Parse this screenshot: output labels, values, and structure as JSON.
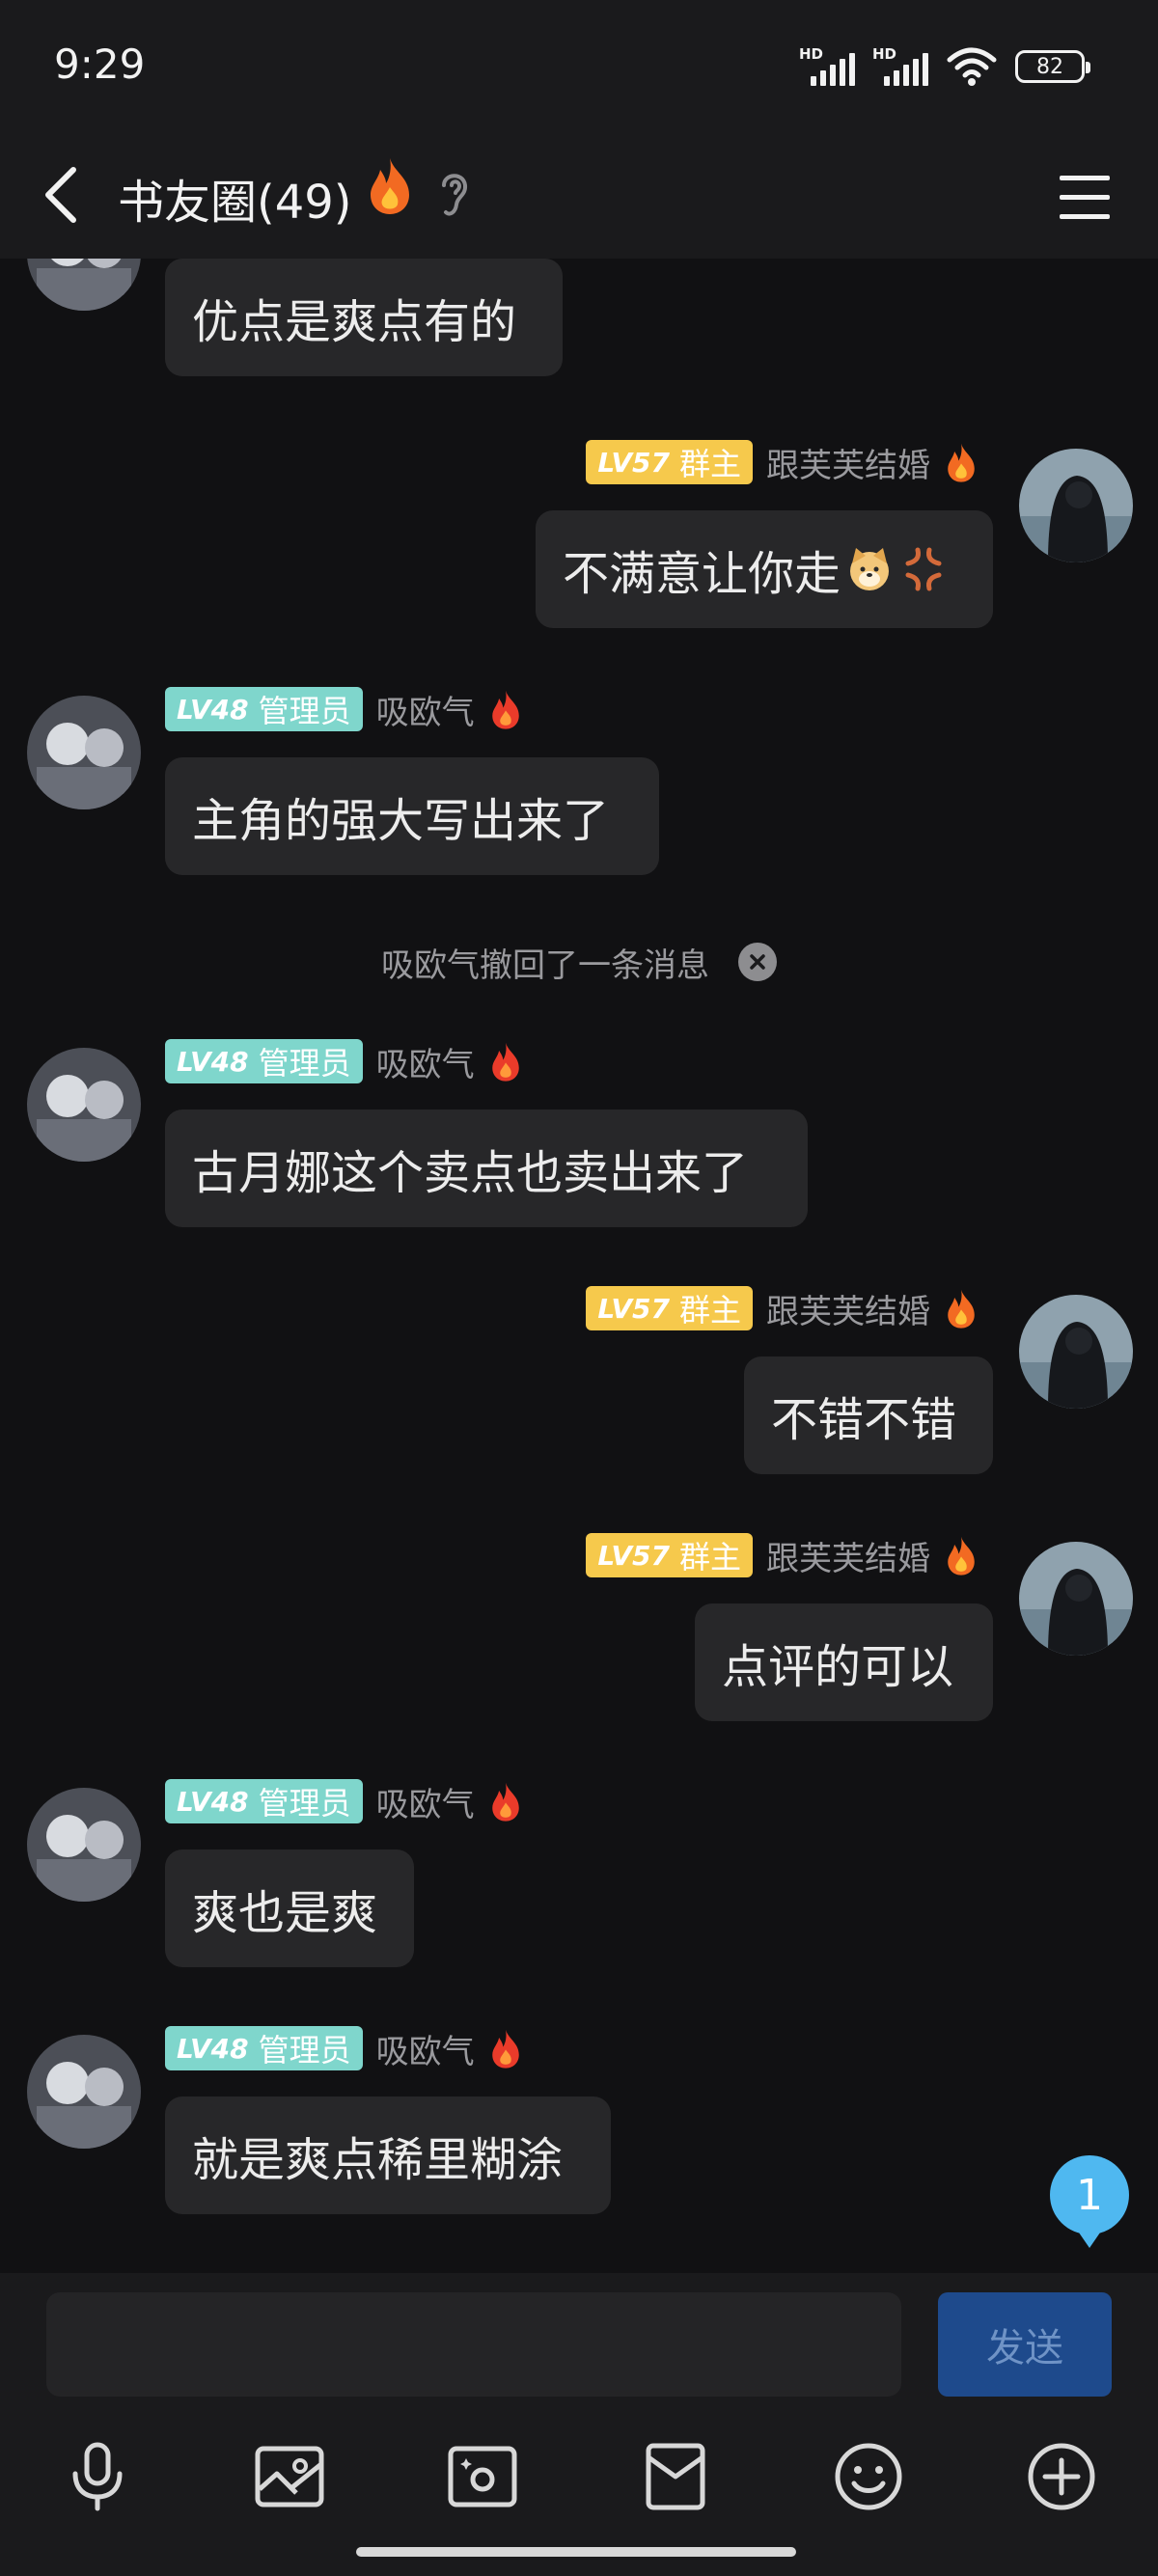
{
  "status_bar": {
    "time": "9:29",
    "signal_label": "HD",
    "battery": "82"
  },
  "header": {
    "title": "书友圈(49)"
  },
  "messages": [
    {
      "side": "left",
      "text": "优点是爽点有的",
      "partial": true
    },
    {
      "side": "right",
      "badge_level": "LV57",
      "badge_role": "群主",
      "name": "跟芙芙结婚",
      "text": "不满意让你走"
    },
    {
      "side": "left",
      "badge_level": "LV48",
      "badge_role": "管理员",
      "name": "吸欧气",
      "text": "主角的强大写出来了"
    },
    {
      "system": "吸欧气撤回了一条消息"
    },
    {
      "side": "left",
      "badge_level": "LV48",
      "badge_role": "管理员",
      "name": "吸欧气",
      "text": "古月娜这个卖点也卖出来了"
    },
    {
      "side": "right",
      "badge_level": "LV57",
      "badge_role": "群主",
      "name": "跟芙芙结婚",
      "text": "不错不错"
    },
    {
      "side": "right",
      "badge_level": "LV57",
      "badge_role": "群主",
      "name": "跟芙芙结婚",
      "text": "点评的可以"
    },
    {
      "side": "left",
      "badge_level": "LV48",
      "badge_role": "管理员",
      "name": "吸欧气",
      "text": "爽也是爽"
    },
    {
      "side": "left",
      "badge_level": "LV48",
      "badge_role": "管理员",
      "name": "吸欧气",
      "text": "就是爽点稀里糊涂"
    }
  ],
  "unread_count": "1",
  "input": {
    "placeholder": "",
    "send_label": "发送"
  },
  "toolbar": [
    "microphone-icon",
    "image-icon",
    "camera-icon",
    "redpacket-icon",
    "emoji-icon",
    "plus-icon"
  ],
  "colors": {
    "admin_badge": "#7fd6cc",
    "owner_badge": "#f6c94c",
    "send_button": "#1e4a8c",
    "unread": "#4fb8f0"
  }
}
